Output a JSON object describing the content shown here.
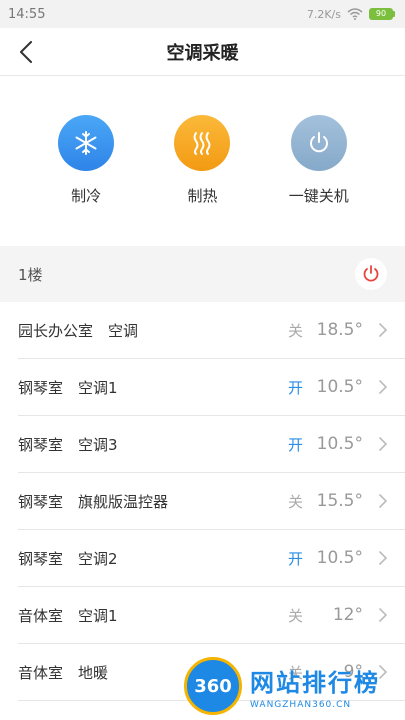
{
  "status_bar": {
    "time": "14:55",
    "speed": "7.2K/s",
    "battery": "90"
  },
  "header": {
    "title": "空调采暖",
    "back_icon": "chevron-left-icon"
  },
  "actions": [
    {
      "label": "制冷",
      "icon": "snowflake-icon",
      "color": "#2f8ff0"
    },
    {
      "label": "制热",
      "icon": "heat-waves-icon",
      "color": "#f7a21b"
    },
    {
      "label": "一键关机",
      "icon": "power-icon",
      "color": "#8fb3d3"
    }
  ],
  "section": {
    "title": "1楼",
    "power_color": "#e8453c"
  },
  "devices": [
    {
      "name": "园长办公室　空调",
      "state": "关",
      "on": false,
      "temp": "18.5°"
    },
    {
      "name": "钢琴室　空调1",
      "state": "开",
      "on": true,
      "temp": "10.5°"
    },
    {
      "name": "钢琴室　空调3",
      "state": "开",
      "on": true,
      "temp": "10.5°"
    },
    {
      "name": "钢琴室　旗舰版温控器",
      "state": "关",
      "on": false,
      "temp": "15.5°"
    },
    {
      "name": "钢琴室　空调2",
      "state": "开",
      "on": true,
      "temp": "10.5°"
    },
    {
      "name": "音体室　空调1",
      "state": "关",
      "on": false,
      "temp": "12°"
    },
    {
      "name": "音体室　地暖",
      "state": "关",
      "on": false,
      "temp": "9°"
    }
  ],
  "watermark": {
    "logo": "360",
    "name": "网站排行榜",
    "domain": "WANGZHAN360.CN"
  },
  "colors": {
    "on": "#2a8ee5",
    "off": "#aaaaaa"
  }
}
